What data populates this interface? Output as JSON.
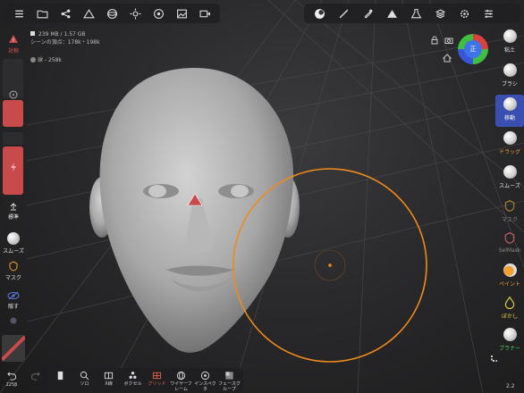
{
  "colors": {
    "accent": "#3b4fb0",
    "danger": "#c84a4a",
    "brush_circle": "#f08a1c",
    "pin_orange": "#f0a030"
  },
  "scene": {
    "memory": "239 MB / 1.57 GB",
    "vertices_label": "シーンの頂点：178k・",
    "vertices_sub": "198k",
    "mesh_label": "球 - 258k"
  },
  "gizmo": {
    "label": "正"
  },
  "topbar_left": {
    "icons": [
      "menu-icon",
      "folder-icon",
      "share-icon",
      "scene-icon",
      "sphere-icon",
      "sun-icon",
      "film-icon",
      "image-icon",
      "video-icon"
    ]
  },
  "topbar_right": {
    "icons": [
      "matcap-icon",
      "pen-icon",
      "dropper-icon",
      "triangle-icon",
      "flask-icon",
      "layers-icon",
      "gear-icon",
      "sliders-icon"
    ]
  },
  "left_col": {
    "symmetry_label": "対称",
    "standard_label": "標準",
    "smooth_label": "スムーズ",
    "mask_label": "マスク",
    "hide_label": "隠す"
  },
  "right_col": {
    "items": [
      {
        "label": "粘土",
        "state": "normal"
      },
      {
        "label": "ブラシ",
        "state": "normal"
      },
      {
        "label": "移動",
        "state": "active"
      },
      {
        "label": "ドラッグ",
        "state": "orange"
      },
      {
        "label": "スムーズ",
        "state": "normal"
      },
      {
        "label": "マスク",
        "state": "dim"
      },
      {
        "label": "SelMask",
        "state": "dim"
      },
      {
        "label": "ペイント",
        "state": "orange"
      },
      {
        "label": "ぼかし",
        "state": "yellow"
      },
      {
        "label": "プラナー",
        "state": "green"
      }
    ]
  },
  "bottom": {
    "undo_label": "225β",
    "buttons": [
      {
        "label": "",
        "icon": "page-icon"
      },
      {
        "label": "ソロ",
        "icon": "search-icon"
      },
      {
        "label": "X線",
        "icon": "xray-icon"
      },
      {
        "label": "ボクセル",
        "icon": "voxel-icon"
      },
      {
        "label": "グリッド",
        "icon": "grid-icon"
      },
      {
        "label": "ワイヤーフレーム",
        "icon": "wireframe-icon"
      },
      {
        "label": "インスペクタ",
        "icon": "inspector-icon"
      },
      {
        "label": "フェースグループ",
        "icon": "facegroup-icon"
      }
    ],
    "version": "2.2"
  }
}
